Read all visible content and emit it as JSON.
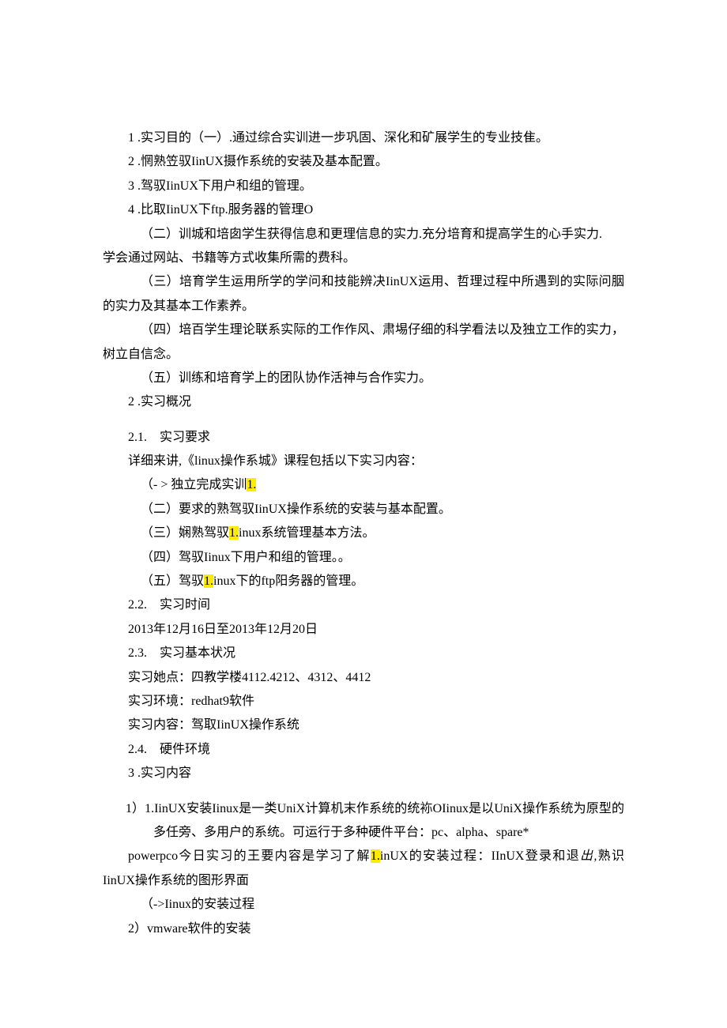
{
  "lines": {
    "l1": "1 .实习目的（一）.通过综合实训进一步巩固、深化和矿展学生的专业技隹。",
    "l2": "2 .惘熟笠驭IinUX摄作系统的安装及基本配置。",
    "l3": "3 .驾驭IinUX下用户和组的管理。",
    "l4": "4 .比取IinUX下ftp.服务器的管理O",
    "l5": "（二）训城和培囱学生获得信息和更理信息的实力.充分培育和提高学生的心手实力.",
    "l5b": "学会通过网站、书籍等方式收集所需的费科。",
    "l6": "（三）培育学生运用所学的学问和技能辨决IinUX运用、哲理过程中所遇到的实际问胭的实力及其基本工作素养。",
    "l7": "（四）培百学生理论联系实际的工作作风、肃埸仔细的科学看法以及独立工作的实力，树立自信念。",
    "l8": "（五）训练和培育学上的团队协作活神与合作实力。",
    "l9": "2 .实习概况",
    "l10": "2.1.　实习要求",
    "l11": "详细来讲,《linux操作系城》课程包括以下实习内容：",
    "l12a": "（- > 独立完成实训",
    "l12b": "1.",
    "l13": "（二）要求的熟驾驭IinUX操作系统的安装与基本配置。",
    "l14a": "（三）娴熟驾驭",
    "l14b": "1.",
    "l14c": "inux系统管理基本方法。",
    "l15": "（四）驾驭Iinux下用户和组的管理。。",
    "l16a": "（五）驾驭",
    "l16b": "1.",
    "l16c": "inux下的ftp阳务器的管理。",
    "l17": "2.2.　实习时间",
    "l18": "2013年12月16日至2013年12月20日",
    "l19": "2.3.　实习基本状况",
    "l20": "实习她点：四教学楼4112.4212、4312、4412",
    "l21": "实习环境：redhat9软件",
    "l22": "实习内容：驾取IinUX操作系统",
    "l23": "2.4.　硬件环境",
    "l24": "3 .实习内容",
    "l25": "1）1.IinUX安装Iinux是一类UniX计算机末作系统的统袮OIinux是以UniX操作系统为原型的多任旁、多用户的系统。可运行于多种硬件平台：pc、alpha、spare*",
    "l26a": "powerpco今日实习的王要内容是学习了解",
    "l26b": "1.",
    "l26c": "inUX的安装过程：IInUX登录和退",
    "l26d": "出,",
    "l26e": "熟识IinUX操作系统的图形界面",
    "l27": "（->Iinux的安装过程",
    "l28": "2）vmware软件的安装"
  }
}
